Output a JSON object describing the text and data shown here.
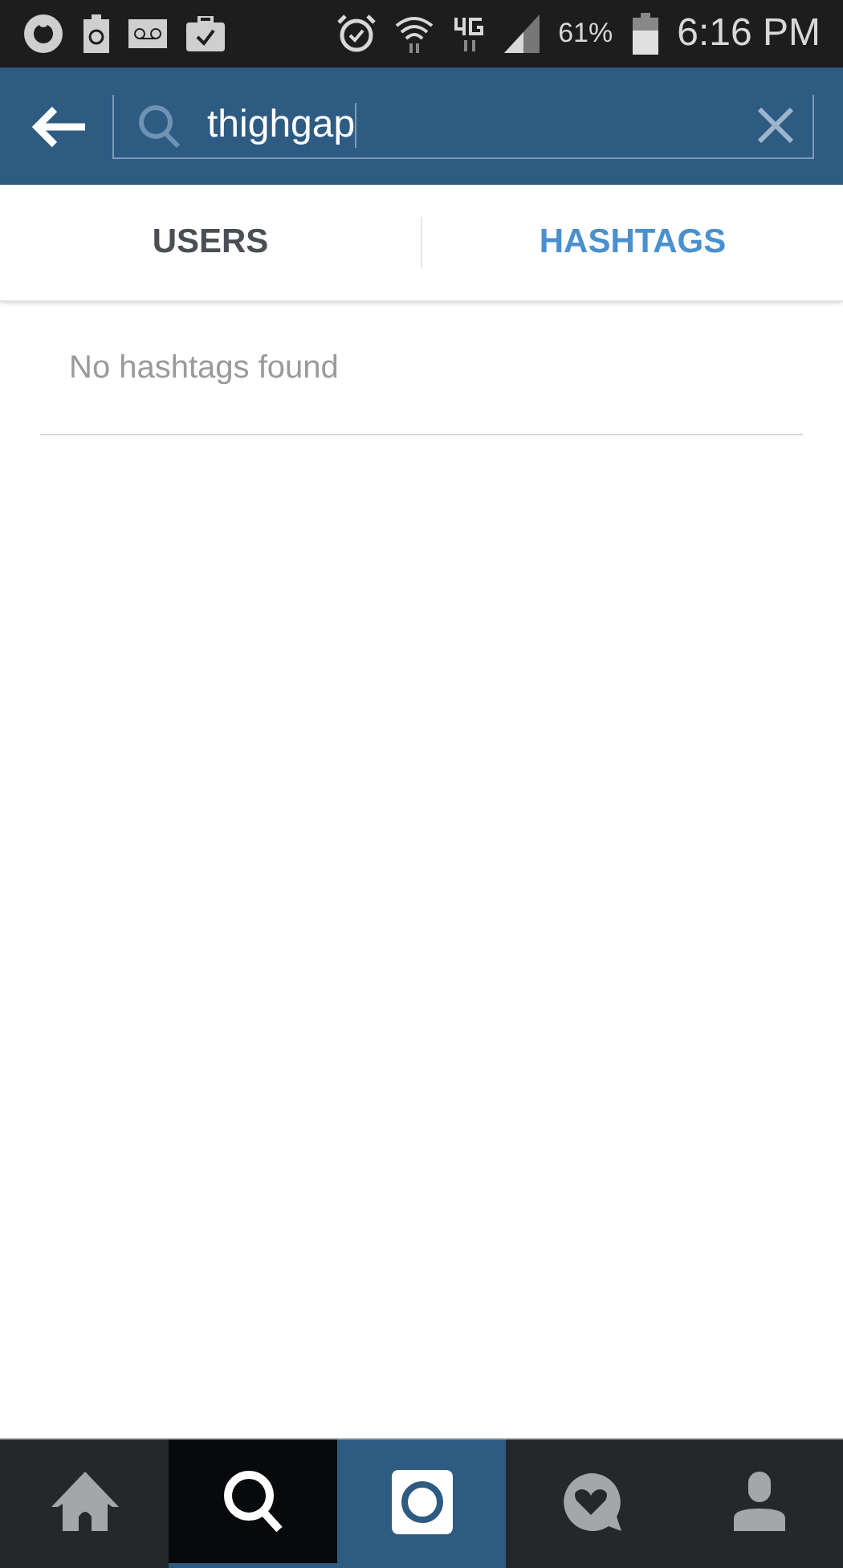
{
  "status_bar": {
    "battery": "61%",
    "time": "6:16 PM"
  },
  "search": {
    "value": "thighgap"
  },
  "tabs": [
    {
      "label": "USERS",
      "selected": false
    },
    {
      "label": "HASHTAGS",
      "selected": true
    }
  ],
  "empty_message": "No hashtags found",
  "nav": [
    {
      "kind": "home",
      "selected": false
    },
    {
      "kind": "search",
      "selected": true
    },
    {
      "kind": "camera",
      "selected": false
    },
    {
      "kind": "activity",
      "selected": false
    },
    {
      "kind": "profile",
      "selected": false
    }
  ]
}
